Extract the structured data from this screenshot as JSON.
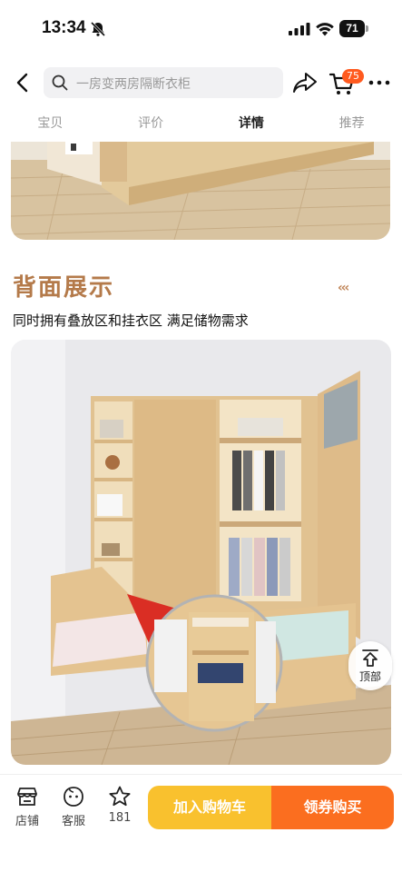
{
  "status": {
    "time": "13:34",
    "battery": "71"
  },
  "nav": {
    "search_placeholder": "一房变两房隔断衣柜",
    "cart_count": "75"
  },
  "tabs": [
    {
      "label": "宝贝"
    },
    {
      "label": "评价"
    },
    {
      "label": "详情"
    },
    {
      "label": "推荐"
    }
  ],
  "active_tab": "详情",
  "section": {
    "title": "背面展示",
    "arrows": "‹‹‹",
    "subtitle": "同时拥有叠放区和挂衣区 满足储物需求"
  },
  "back_to_top": {
    "label": "顶部"
  },
  "bottom_bar": {
    "store_label": "店铺",
    "service_label": "客服",
    "favorite_count": "181",
    "add_to_cart": "加入购物车",
    "buy_now": "领券购买"
  },
  "colors": {
    "accent_title": "#b47a4a",
    "cart_button": "#f9c12e",
    "buy_button": "#fb6e1f",
    "badge": "#ff5a1f"
  }
}
